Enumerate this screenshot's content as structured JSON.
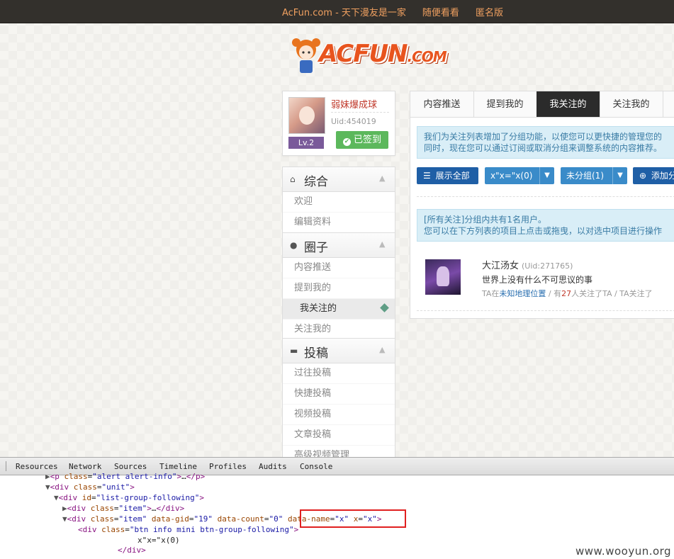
{
  "topbar": {
    "site": "AcFun.com - 天下漫友是一家",
    "random": "随便看看",
    "anon": "匿名版"
  },
  "logo": {
    "text": "ACFUN",
    "suffix": ".COM"
  },
  "user": {
    "name": "弱妹爆成球",
    "uid": "Uid:454019",
    "level": "Lv.2",
    "signed": "已签到"
  },
  "menus": {
    "general": {
      "title": "综合",
      "items": [
        "欢迎",
        "编辑资料"
      ]
    },
    "circle": {
      "title": "圈子",
      "items": [
        "内容推送",
        "提到我的",
        "我关注的",
        "关注我的"
      ],
      "active": "我关注的"
    },
    "posts": {
      "title": "投稿",
      "items": [
        "过往投稿",
        "快捷投稿",
        "视频投稿",
        "文章投稿",
        "高级视频管理"
      ]
    }
  },
  "tabs": [
    "内容推送",
    "提到我的",
    "我关注的",
    "关注我的"
  ],
  "alert1": {
    "line1": "我们为关注列表增加了分组功能，以使您可以更快捷的管理您的",
    "line2": "同时，现在您可以通过订阅或取消分组来调整系统的内容推荐。"
  },
  "buttons": {
    "showAll": "展示全部",
    "group": "x\"x=\"x(0)",
    "ungrouped": "未分组(1)",
    "add": "添加分"
  },
  "alert2": {
    "line1": "[所有关注]分组内共有1名用户。",
    "line2": "您可以在下方列表的项目上点击或拖曳，以对选中项目进行操作"
  },
  "follow": {
    "name": "大江汤女",
    "uid": "(Uid:271765)",
    "motto": "世界上没有什么不可思议的事",
    "meta_prefix": "TA在",
    "location": "未知地理位置",
    "meta_mid": " / 有",
    "count": "27",
    "meta_suffix": "人关注了TA / TA关注了"
  },
  "devtools": {
    "tabs": [
      "Resources",
      "Network",
      "Sources",
      "Timeline",
      "Profiles",
      "Audits",
      "Console"
    ]
  },
  "watermark": "www.wooyun.org",
  "colors": {
    "accent": "#e8541e",
    "primary": "#1f5fa6",
    "success": "#5cb85c",
    "highlight": "#e02020"
  }
}
